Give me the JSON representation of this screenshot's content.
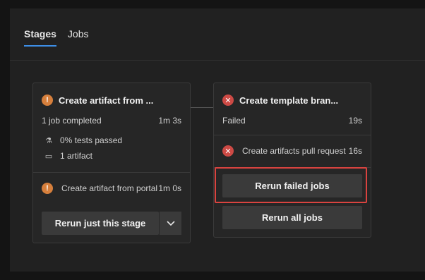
{
  "tabs": [
    {
      "label": "Stages",
      "active": true
    },
    {
      "label": "Jobs",
      "active": false
    }
  ],
  "stage1": {
    "title": "Create artifact from ...",
    "status_icon": "warning-icon",
    "summary_label": "1 job completed",
    "summary_time": "1m 3s",
    "tests_label": "0% tests passed",
    "artifact_label": "1 artifact",
    "job_name": "Create artifact from portal",
    "job_time": "1m 0s",
    "rerun_label": "Rerun just this stage"
  },
  "stage2": {
    "title": "Create template bran...",
    "status_icon": "error-icon",
    "summary_label": "Failed",
    "summary_time": "19s",
    "job_name": "Create artifacts pull request",
    "job_time": "16s",
    "rerun_failed_label": "Rerun failed jobs",
    "rerun_all_label": "Rerun all jobs"
  },
  "colors": {
    "accent": "#3d8ee6",
    "warning": "#d67f3c",
    "error": "#cd4a45",
    "highlight": "#d9433f"
  }
}
